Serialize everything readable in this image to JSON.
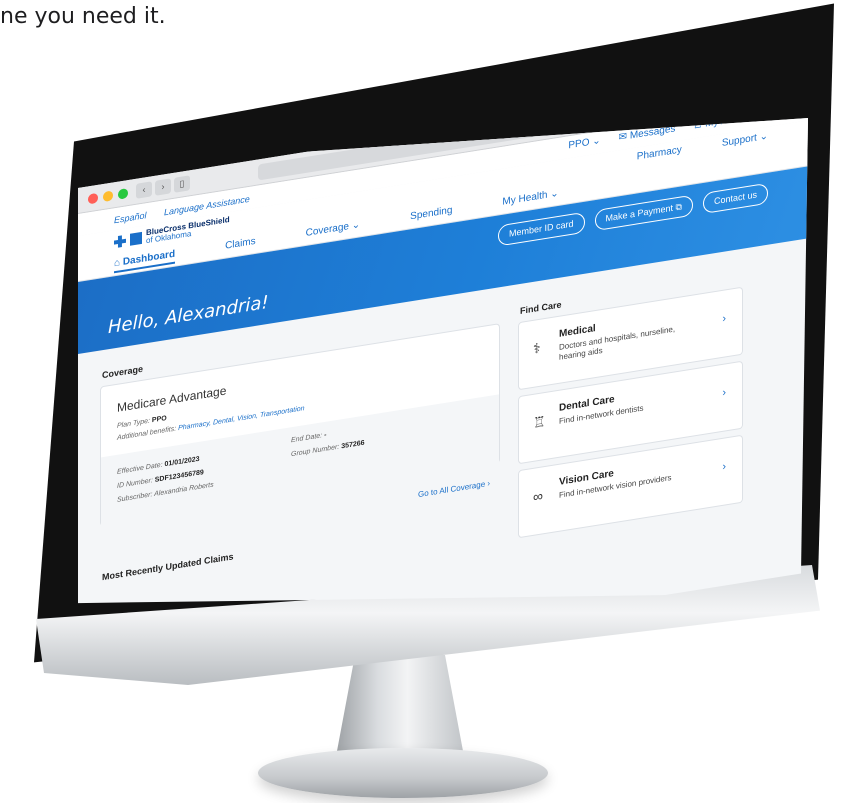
{
  "tagline": "ne you need it.",
  "browser": {
    "back": "‹",
    "forward": "›",
    "sidebar": "▯",
    "reload": "↻",
    "share": "⇪",
    "tabs": "⧉",
    "newtab": "+"
  },
  "topbar": {
    "espanol": "Español",
    "language_assistance": "Language Assistance",
    "plan": "PPO ⌄",
    "messages": "✉ Messages",
    "account": "♙ My Account ⌄"
  },
  "header": {
    "brand_line1": "BlueCross BlueShield",
    "brand_line2": "of Oklahoma",
    "pharmacy": "Pharmacy",
    "support": "Support ⌄",
    "nav": {
      "dashboard": "⌂ Dashboard",
      "claims": "Claims",
      "coverage": "Coverage ⌄",
      "spending": "Spending",
      "my_health": "My Health ⌄"
    }
  },
  "hero": {
    "greeting": "Hello, Alexandria!",
    "member_id": "Member ID card",
    "payment": "Make a Payment ⧉",
    "contact": "Contact us"
  },
  "coverage": {
    "section_label": "Coverage",
    "title": "Medicare Advantage",
    "plan_type_label": "Plan Type:",
    "plan_type": "PPO",
    "benefits_label": "Additional benefits:",
    "benefits": "Pharmacy, Dental, Vision, Transportation",
    "effective_label": "Effective Date:",
    "effective": "01/01/2023",
    "id_label": "ID Number:",
    "id": "SDF123456789",
    "subscriber_label": "Subscriber:",
    "subscriber": "Alexandria Roberts",
    "end_label": "End Date:",
    "end": "-",
    "group_label": "Group Number:",
    "group": "357266",
    "go_all": "Go to All Coverage ›"
  },
  "claims": {
    "section_label": "Most Recently Updated Claims"
  },
  "find_care": {
    "section_label": "Find Care",
    "items": [
      {
        "icon": "stethoscope-icon",
        "glyph": "⚕",
        "title": "Medical",
        "desc": "Doctors and hospitals, nurseline, hearing aids"
      },
      {
        "icon": "tooth-icon",
        "glyph": "♖",
        "title": "Dental Care",
        "desc": "Find in-network dentists"
      },
      {
        "icon": "glasses-icon",
        "glyph": "∞",
        "title": "Vision Care",
        "desc": "Find in-network vision providers"
      }
    ],
    "chevron": "›"
  },
  "colors": {
    "brand_blue": "#1a6fc9",
    "hero_blue": "#1e7fd8"
  }
}
